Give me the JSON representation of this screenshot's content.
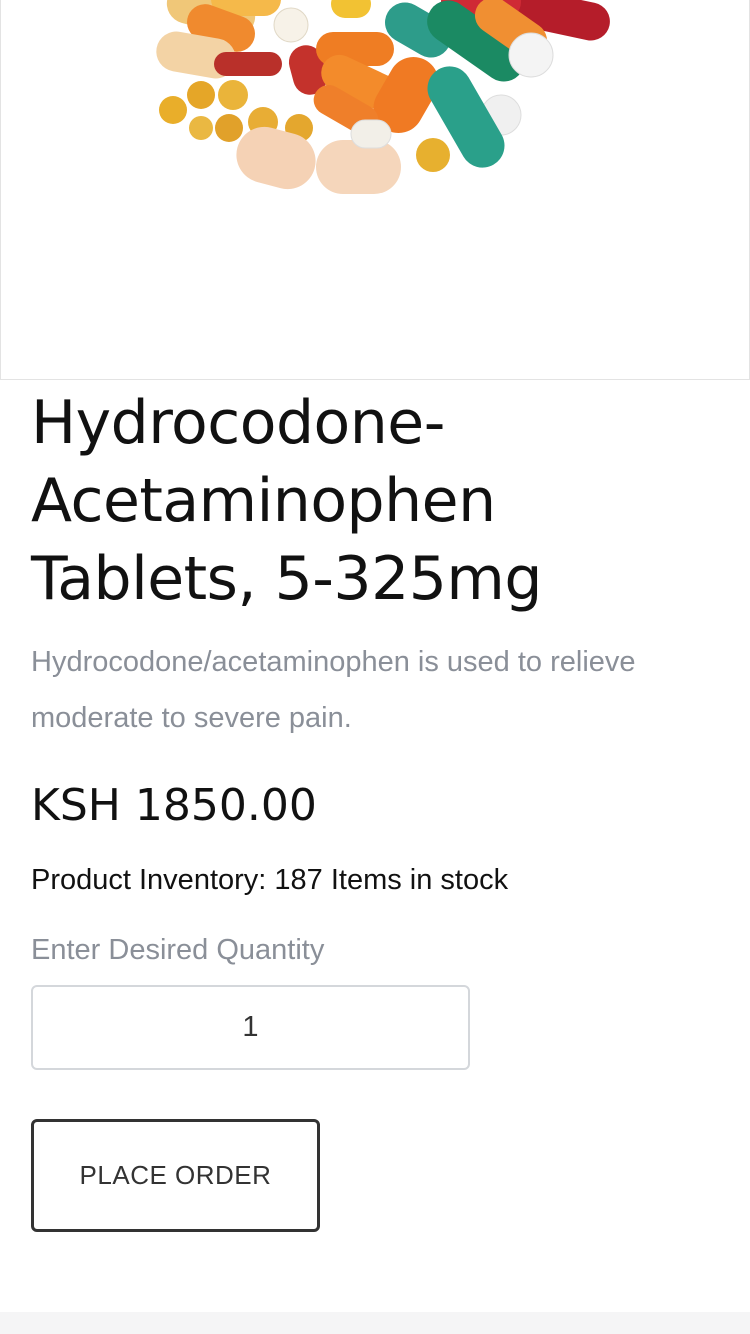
{
  "product": {
    "image_name": "pills-photo",
    "title": "Hydrocodone-Acetaminophen Tablets, 5-325mg",
    "description": "Hydrocodone/acetaminophen is used to relieve moderate to severe pain.",
    "price": "KSH 1850.00",
    "inventory": "Product Inventory: 187 Items in stock"
  },
  "order": {
    "quantity_label": "Enter Desired Quantity",
    "quantity_value": "1",
    "place_order_label": "PLACE ORDER"
  },
  "colors": {
    "muted_text": "#8a8f98",
    "button_border": "#333333",
    "input_border": "#d4d7db"
  }
}
